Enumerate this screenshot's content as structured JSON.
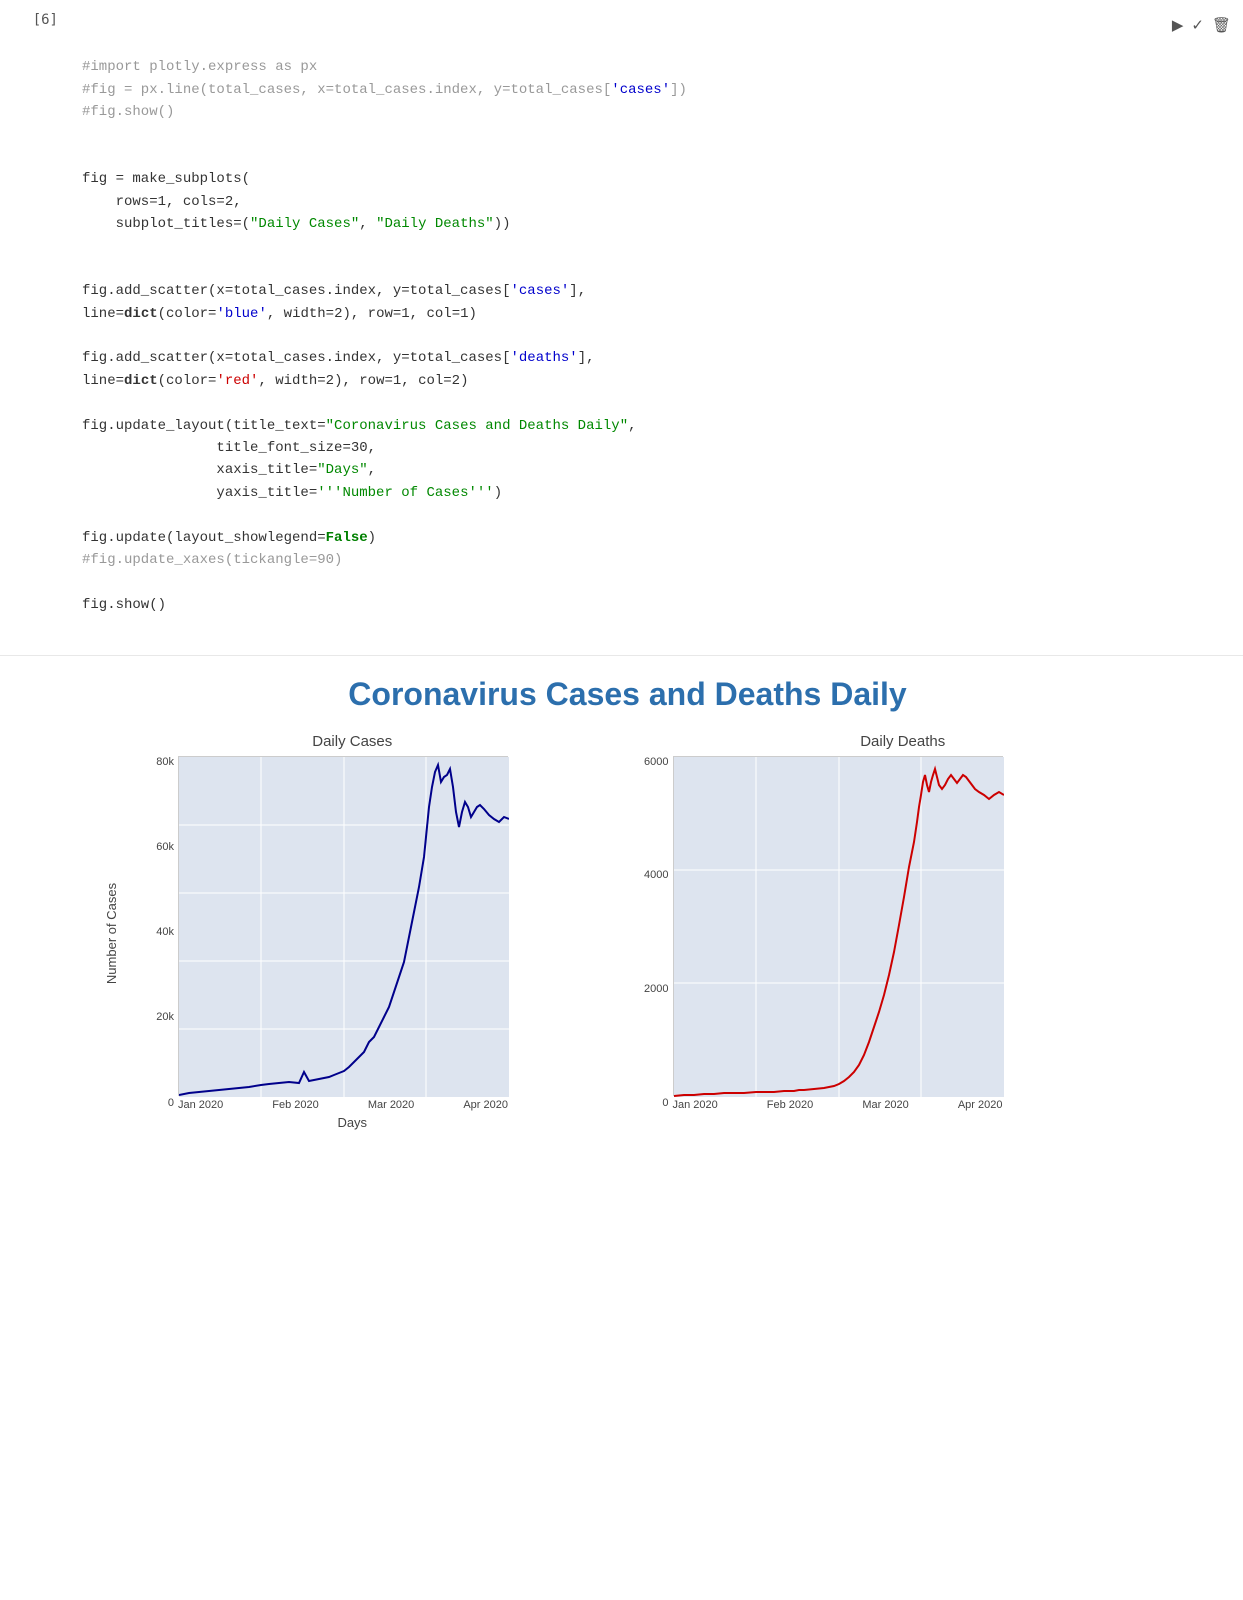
{
  "cell": {
    "label": "[6]",
    "code_lines": [
      {
        "type": "comment",
        "text": "#import plotly.express as px"
      },
      {
        "type": "comment",
        "text": "#fig = px.line(total_cases, x=total_cases.index, y=total_cases['cases'])"
      },
      {
        "type": "comment",
        "text": "#fig.show()"
      },
      {
        "type": "blank"
      },
      {
        "type": "blank"
      },
      {
        "type": "code",
        "text": "fig = make_subplots("
      },
      {
        "type": "code",
        "text": "    rows=1, cols=2,"
      },
      {
        "type": "code_string",
        "text": "    subplot_titles=(\"Daily Cases\", \"Daily Deaths\"))"
      },
      {
        "type": "blank"
      },
      {
        "type": "blank"
      },
      {
        "type": "code_string",
        "text": "fig.add_scatter(x=total_cases.index, y=total_cases['cases'],"
      },
      {
        "type": "code_dict",
        "text": "line=dict(color='blue', width=2), row=1, col=1)"
      },
      {
        "type": "blank"
      },
      {
        "type": "code_string",
        "text": "fig.add_scatter(x=total_cases.index, y=total_cases['deaths'],"
      },
      {
        "type": "code_dict2",
        "text": "line=dict(color='red', width=2), row=1, col=2)"
      },
      {
        "type": "blank"
      },
      {
        "type": "code_update",
        "text": "fig.update_layout(title_text=\"Coronavirus Cases and Deaths Daily\","
      },
      {
        "type": "code",
        "text": "                title_font_size=30,"
      },
      {
        "type": "code_xaxis",
        "text": "                xaxis_title=\"Days\","
      },
      {
        "type": "code_yaxis",
        "text": "                yaxis_title='''Number of Cases''')"
      },
      {
        "type": "blank"
      },
      {
        "type": "code_false",
        "text": "fig.update(layout_showlegend=False)"
      },
      {
        "type": "comment",
        "text": "#fig.update_xaxes(tickangle=90)"
      },
      {
        "type": "blank"
      },
      {
        "type": "code",
        "text": "fig.show()"
      }
    ],
    "toolbar": {
      "run_icon": "▶",
      "check_icon": "✓",
      "delete_icon": "🗑"
    }
  },
  "output": {
    "title": "Coronavirus Cases and Deaths Daily",
    "chart_left": {
      "subtitle": "Daily Cases",
      "y_label": "Number of Cases",
      "x_label": "Days",
      "y_ticks": [
        "80k",
        "60k",
        "40k",
        "20k",
        "0"
      ],
      "x_ticks": [
        "Jan 2020",
        "Feb 2020",
        "Mar 2020",
        "Apr 2020"
      ]
    },
    "chart_right": {
      "subtitle": "Daily Deaths",
      "y_ticks": [
        "6000",
        "4000",
        "2000",
        "0"
      ],
      "x_ticks": [
        "Jan 2020",
        "Feb 2020",
        "Mar 2020",
        "Apr 2020"
      ]
    }
  }
}
